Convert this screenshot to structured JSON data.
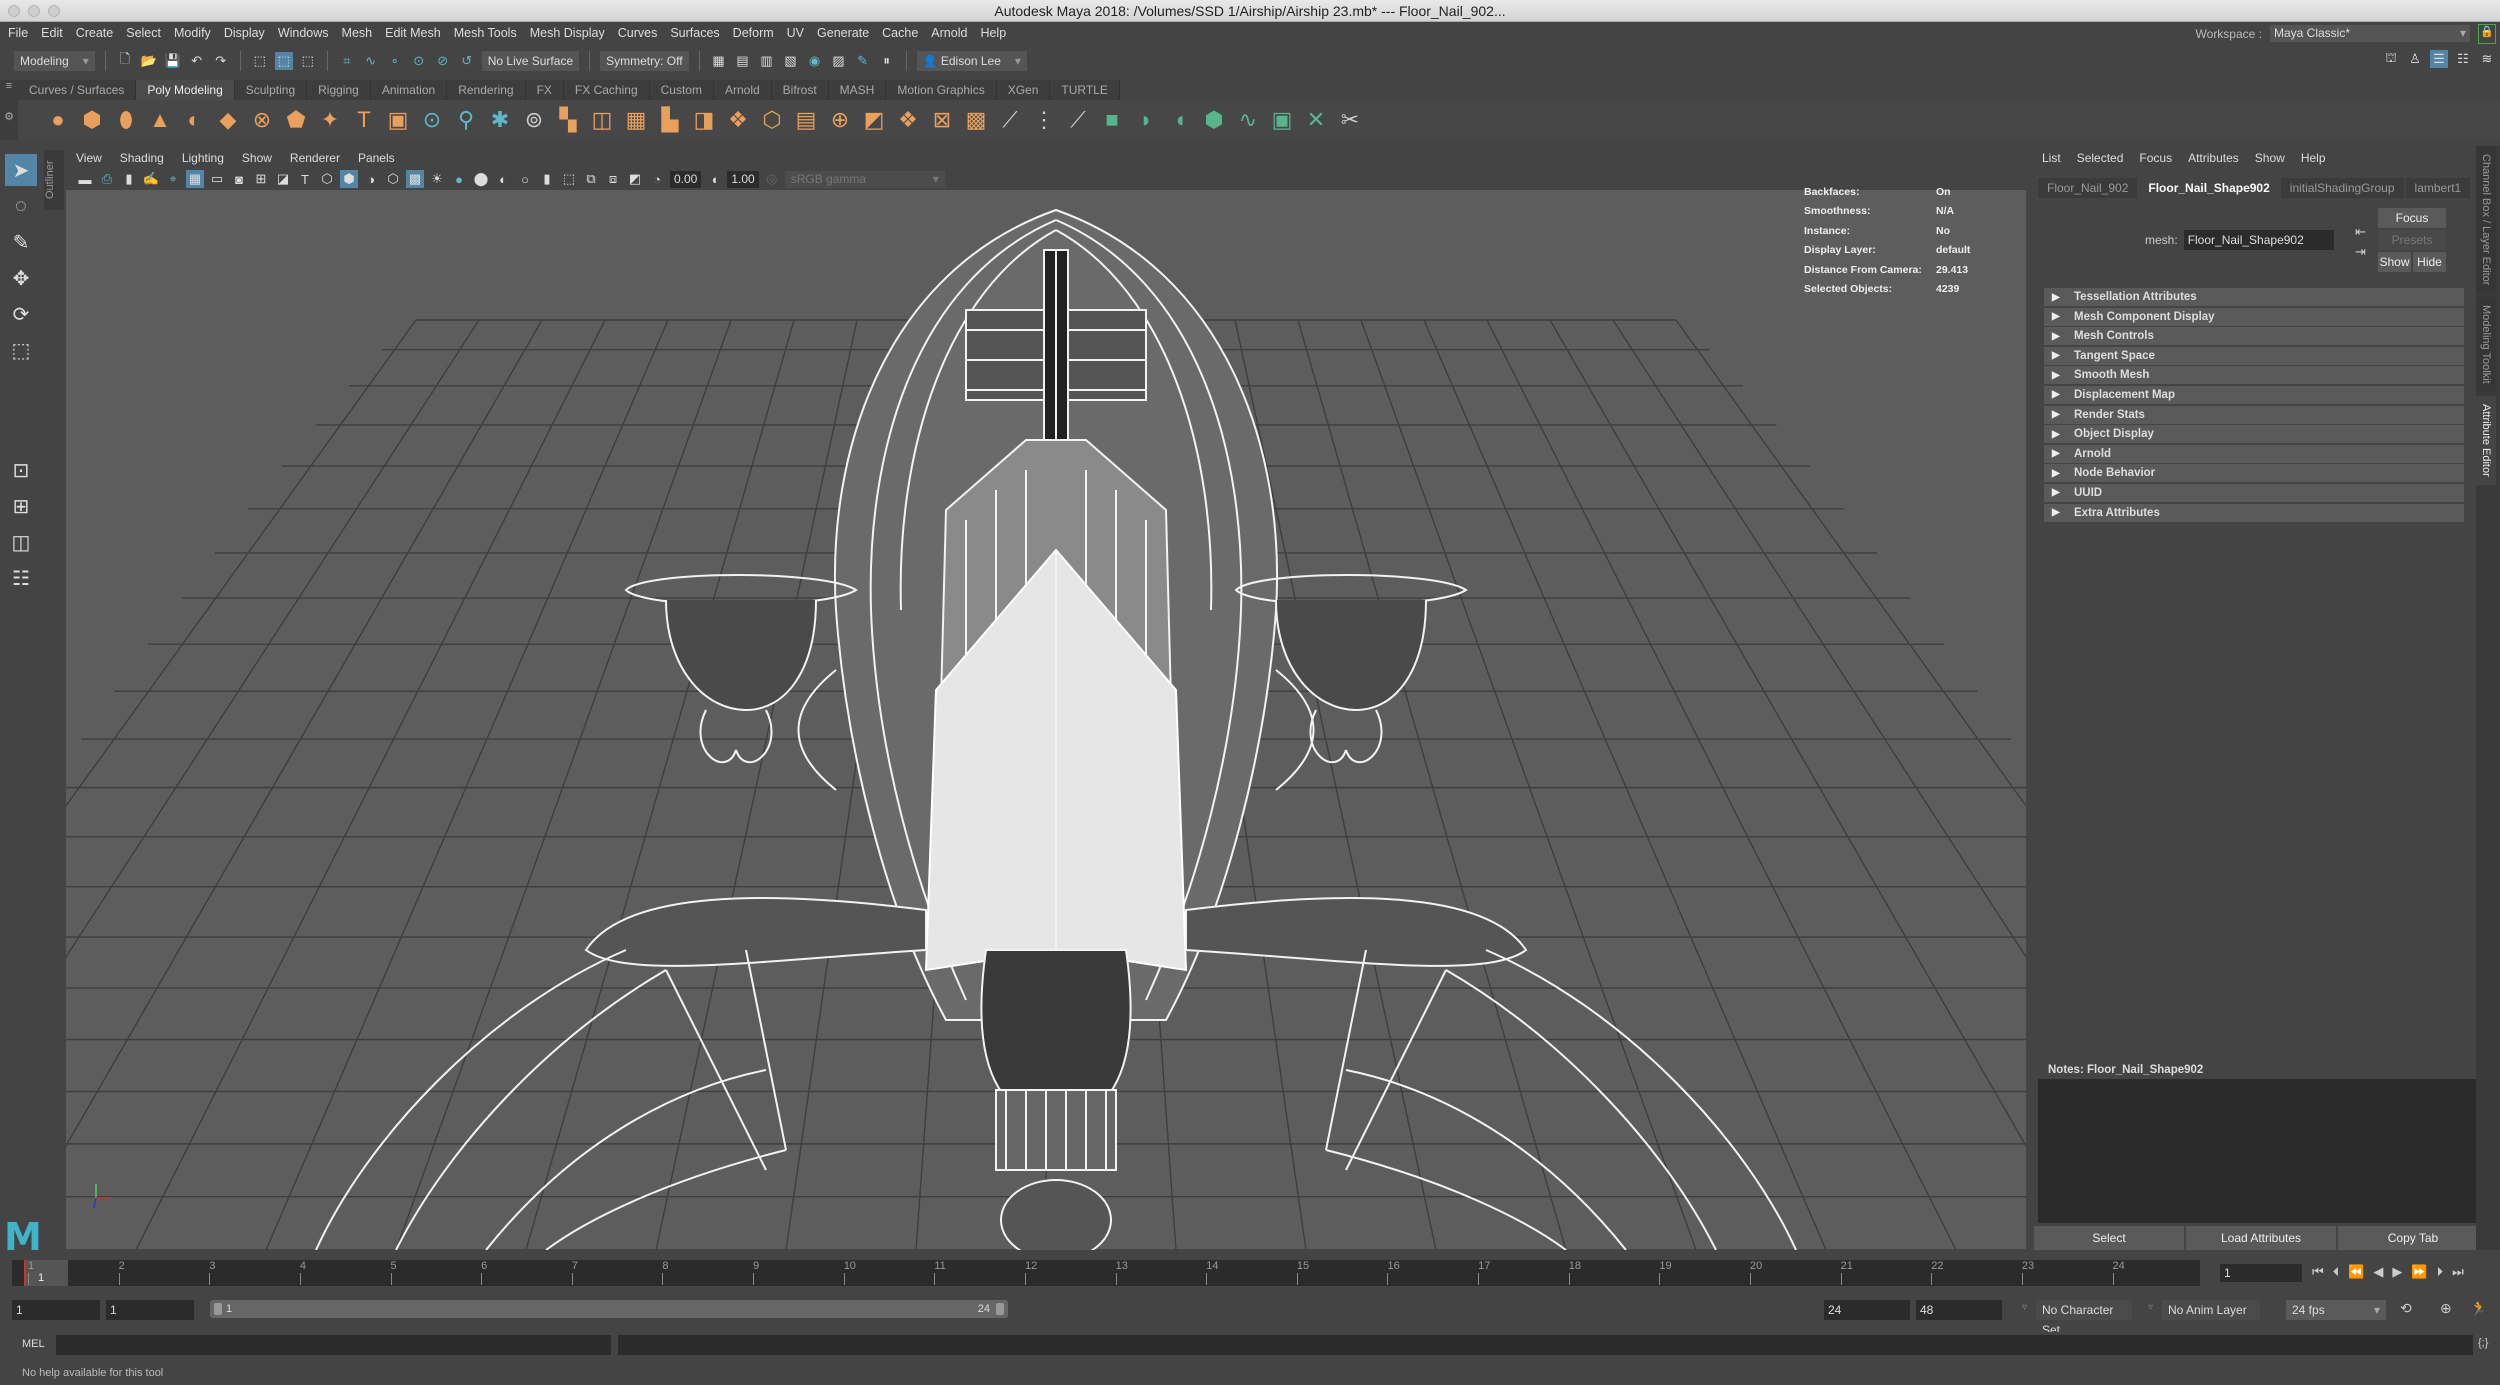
{
  "window": {
    "title": "Autodesk Maya 2018: /Volumes/SSD 1/Airship/Airship 23.mb*   ---   Floor_Nail_902..."
  },
  "menubar": [
    "File",
    "Edit",
    "Create",
    "Select",
    "Modify",
    "Display",
    "Windows",
    "Mesh",
    "Edit Mesh",
    "Mesh Tools",
    "Mesh Display",
    "Curves",
    "Surfaces",
    "Deform",
    "UV",
    "Generate",
    "Cache",
    "Arnold",
    "Help"
  ],
  "workspace": {
    "label": "Workspace :",
    "value": "Maya Classic*"
  },
  "statusline": {
    "mode": "Modeling",
    "live_surface": "No Live Surface",
    "symmetry": "Symmetry: Off",
    "user": "Edison Lee"
  },
  "shelf": {
    "tabs": [
      "Curves / Surfaces",
      "Poly Modeling",
      "Sculpting",
      "Rigging",
      "Animation",
      "Rendering",
      "FX",
      "FX Caching",
      "Custom",
      "Arnold",
      "Bifrost",
      "MASH",
      "Motion Graphics",
      "XGen",
      "TURTLE"
    ],
    "active_tab": "Poly Modeling"
  },
  "outliner_tab": "Outliner",
  "viewport": {
    "menu": [
      "View",
      "Shading",
      "Lighting",
      "Show",
      "Renderer",
      "Panels"
    ],
    "exposure": "0.00",
    "gamma": "1.00",
    "color_space": "sRGB gamma",
    "hud": [
      {
        "key": "Backfaces:",
        "value": "On"
      },
      {
        "key": "Smoothness:",
        "value": "N/A"
      },
      {
        "key": "Instance:",
        "value": "No"
      },
      {
        "key": "Display Layer:",
        "value": "default"
      },
      {
        "key": "Distance From Camera:",
        "value": "29.413"
      },
      {
        "key": "Selected Objects:",
        "value": "4239"
      }
    ],
    "axis": {
      "y": "y",
      "x": "x",
      "z": "z"
    }
  },
  "attribute_editor": {
    "menu": [
      "List",
      "Selected",
      "Focus",
      "Attributes",
      "Show",
      "Help"
    ],
    "tabs": [
      "Floor_Nail_902",
      "Floor_Nail_Shape902",
      "initialShadingGroup",
      "lambert1"
    ],
    "active_tab": "Floor_Nail_Shape902",
    "mesh_label": "mesh:",
    "mesh_value": "Floor_Nail_Shape902",
    "focus_btn": "Focus",
    "presets_btn": "Presets",
    "show_btn": "Show",
    "hide_btn": "Hide",
    "sections": [
      "Tessellation Attributes",
      "Mesh Component Display",
      "Mesh Controls",
      "Tangent Space",
      "Smooth Mesh",
      "Displacement Map",
      "Render Stats",
      "Object Display",
      "Arnold",
      "Node Behavior",
      "UUID",
      "Extra Attributes"
    ],
    "notes_label": "Notes:  Floor_Nail_Shape902",
    "bottom_buttons": [
      "Select",
      "Load Attributes",
      "Copy Tab"
    ]
  },
  "side_tabs": [
    "Channel Box / Layer Editor",
    "Modeling Toolkit",
    "Attribute Editor"
  ],
  "timeline": {
    "ticks": [
      "1",
      "2",
      "3",
      "4",
      "5",
      "6",
      "7",
      "8",
      "9",
      "10",
      "11",
      "12",
      "13",
      "14",
      "15",
      "16",
      "17",
      "18",
      "19",
      "20",
      "21",
      "22",
      "23",
      "24"
    ],
    "current_frame": "1",
    "current_frame_field": "1"
  },
  "range": {
    "start": "1",
    "playback_start": "1",
    "slider_start": "1",
    "slider_end": "24",
    "playback_end": "24",
    "end": "48",
    "character_set": "No Character Set",
    "anim_layer": "No Anim Layer",
    "fps": "24 fps"
  },
  "command_line": {
    "label": "MEL"
  },
  "help_line": "No help available for this tool"
}
